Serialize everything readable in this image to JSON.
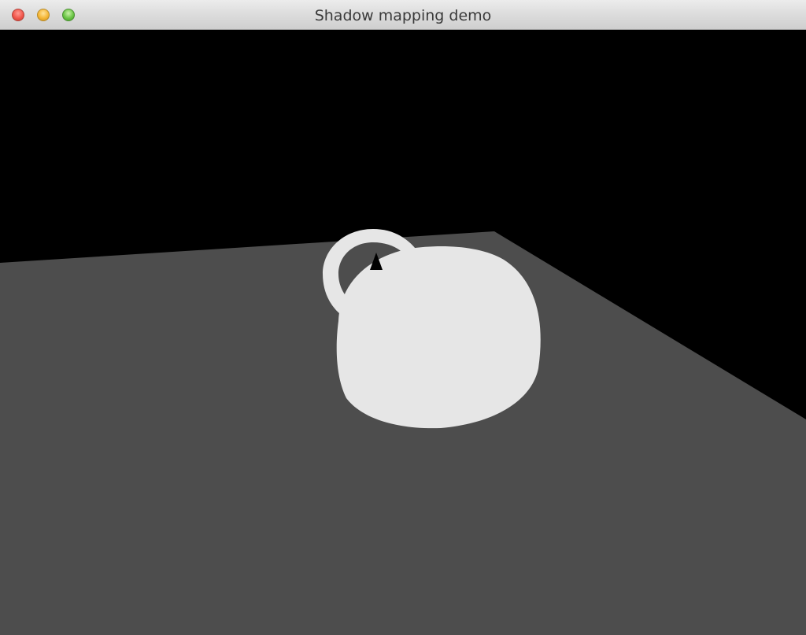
{
  "window": {
    "title": "Shadow mapping demo",
    "controls": [
      {
        "name": "close",
        "color": "#f2574c"
      },
      {
        "name": "minimize",
        "color": "#f5b636"
      },
      {
        "name": "zoom",
        "color": "#6ac545"
      }
    ]
  },
  "scene": {
    "background_color": "#000000",
    "ground_plane_color": "#4d4d4d",
    "teapot_color": "#e6e6e6"
  }
}
